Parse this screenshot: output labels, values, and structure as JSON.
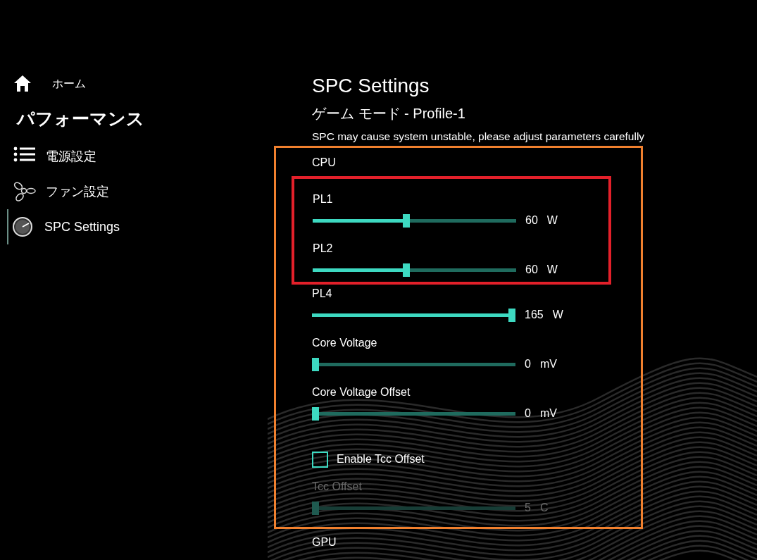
{
  "sidebar": {
    "home": {
      "label": "ホーム"
    },
    "section_title": "パフォーマンス",
    "items": [
      {
        "label": "電源設定",
        "selected": false
      },
      {
        "label": "ファン設定",
        "selected": false
      },
      {
        "label": "SPC Settings",
        "selected": true
      }
    ]
  },
  "page": {
    "title": "SPC Settings",
    "subtitle": "ゲーム モード - Profile-1",
    "warning": "SPC may cause system unstable, please adjust parameters carefully"
  },
  "cpu_panel": {
    "color": "#f0802e",
    "heading": "CPU",
    "items": [
      {
        "kind": "group",
        "color": "#e3202a",
        "items": [
          {
            "kind": "slider",
            "label": "PL1",
            "level": 0.46,
            "value": "60",
            "unit": "W",
            "disabled": false
          },
          {
            "kind": "slider",
            "label": "PL2",
            "level": 0.46,
            "value": "60",
            "unit": "W",
            "disabled": false
          }
        ]
      },
      {
        "kind": "slider",
        "label": "PL4",
        "level": 1,
        "value": "165",
        "unit": "W",
        "disabled": false
      },
      {
        "kind": "slider",
        "label": "Core Voltage",
        "level": 0,
        "value": "0",
        "unit": "mV",
        "disabled": false
      },
      {
        "kind": "slider",
        "label": "Core Voltage Offset",
        "level": 0,
        "value": "0",
        "unit": "mV",
        "disabled": false
      },
      {
        "kind": "checkbox",
        "label": "Enable Tcc Offset",
        "checked": false
      },
      {
        "kind": "slider",
        "label": "Tcc Offset",
        "level": 0,
        "value": "5",
        "unit": "C",
        "disabled": true
      }
    ]
  },
  "gpu_heading": "GPU"
}
